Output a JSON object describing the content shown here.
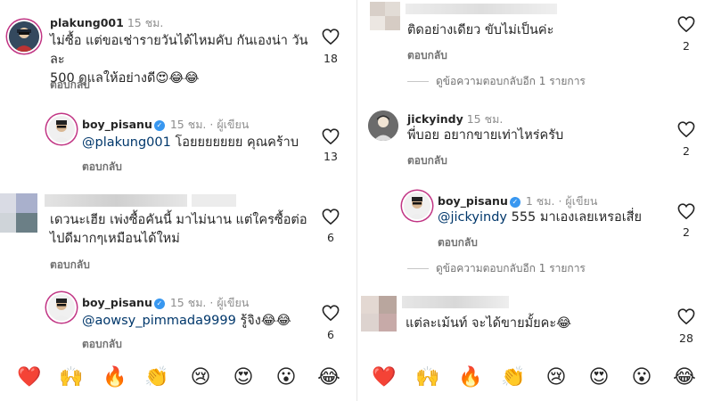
{
  "left": {
    "c1": {
      "username": "plakung001",
      "time": "15 ชม.",
      "line1": "ไม่ซื้อ แต่ขอเช่ารายวันได้ไหมคับ กันเองน่า วันละ",
      "line2": "500 ดูแลให้อย่างดี😍😂😂",
      "likes": "18",
      "reply": "ตอบกลับ"
    },
    "r1": {
      "username": "boy_pisanu",
      "time": "15 ชม.",
      "role": "· ผู้เขียน",
      "mention": "@plakung001",
      "text": " โอยยยยยยย คุณคร้าบ",
      "likes": "13",
      "reply": "ตอบกลับ"
    },
    "c2": {
      "line1": "เดวนะเฮีย เพ่งซื้อคันนี้ มาไม่นาน  แต่ใครซื้อต่อ",
      "line2": "ไปดีมากๆเหมือนได้ใหม่",
      "likes": "6",
      "reply": "ตอบกลับ"
    },
    "r2": {
      "username": "boy_pisanu",
      "time": "15 ชม.",
      "role": "· ผู้เขียน",
      "mention": "@aowsy_pimmada9999",
      "text": " รู้จิง😂😂",
      "likes": "6",
      "reply": "ตอบกลับ"
    }
  },
  "right": {
    "c1": {
      "text": "ติดอย่างเดียว ขับไม่เป็นค่ะ",
      "likes": "2",
      "reply": "ตอบกลับ",
      "view_more": "ดูข้อความตอบกลับอีก 1 รายการ"
    },
    "c2": {
      "username": "jickyindy",
      "time": "15 ชม.",
      "text": "พี่บอย อยากขายเท่าไหร่ครับ",
      "likes": "2",
      "reply": "ตอบกลับ"
    },
    "r1": {
      "username": "boy_pisanu",
      "time": "1 ชม.",
      "role": "· ผู้เขียน",
      "mention": "@jickyindy",
      "text": " 555 มาเองเลยเหรอเสี่ย",
      "likes": "2",
      "reply": "ตอบกลับ",
      "view_more": "ดูข้อความตอบกลับอีก 1 รายการ"
    },
    "c3": {
      "text": "แต่ละเม้นท์ จะได้ขายมั้ยคะ😂",
      "likes": "28"
    }
  },
  "emojis": [
    "❤️",
    "🙌",
    "🔥",
    "👏",
    "😢",
    "😍",
    "😮",
    "😂"
  ],
  "colors": {
    "verified": "#3897f0",
    "mention": "#00376b",
    "muted": "#8e8e8e",
    "text": "#262626"
  }
}
